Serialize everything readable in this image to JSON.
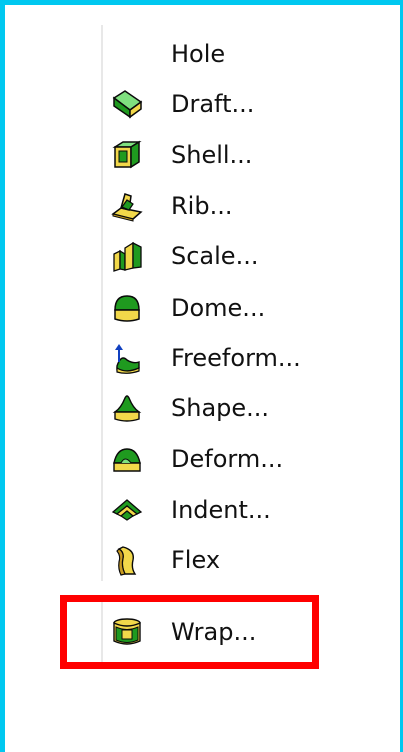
{
  "menu": {
    "items": [
      {
        "label": "Hole",
        "icon": "hole-icon"
      },
      {
        "label": "Draft...",
        "icon": "draft-icon"
      },
      {
        "label": "Shell...",
        "icon": "shell-icon"
      },
      {
        "label": "Rib...",
        "icon": "rib-icon"
      },
      {
        "label": "Scale...",
        "icon": "scale-icon"
      },
      {
        "label": "Dome...",
        "icon": "dome-icon"
      },
      {
        "label": "Freeform...",
        "icon": "freeform-icon"
      },
      {
        "label": "Shape...",
        "icon": "shape-icon"
      },
      {
        "label": "Deform...",
        "icon": "deform-icon"
      },
      {
        "label": "Indent...",
        "icon": "indent-icon"
      },
      {
        "label": "Flex",
        "icon": "flex-icon"
      }
    ],
    "wrap": {
      "label": "Wrap...",
      "icon": "wrap-icon"
    }
  },
  "colors": {
    "frame": "#00c8f0",
    "highlight": "#ff0000",
    "icon_green": "#22a022",
    "icon_yellow": "#f0d040"
  }
}
